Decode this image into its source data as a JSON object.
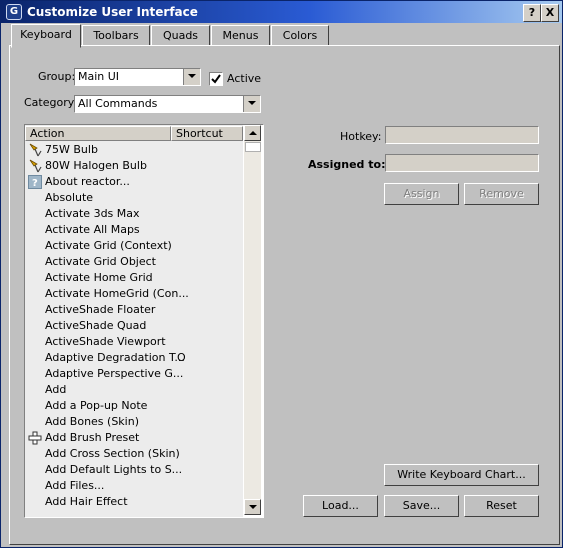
{
  "window": {
    "title": "Customize User Interface",
    "help_label": "?",
    "close_label": "X"
  },
  "tabs": [
    {
      "label": "Keyboard"
    },
    {
      "label": "Toolbars"
    },
    {
      "label": "Quads"
    },
    {
      "label": "Menus"
    },
    {
      "label": "Colors"
    }
  ],
  "group": {
    "label": "Group:",
    "value": "Main UI"
  },
  "active": {
    "label": "Active",
    "checked": true
  },
  "category": {
    "label": "Category:",
    "value": "All Commands"
  },
  "list": {
    "headers": {
      "action": "Action",
      "shortcut": "Shortcut"
    },
    "rows": [
      {
        "icon": "lamp-icon",
        "name": "75W Bulb",
        "shortcut": ""
      },
      {
        "icon": "lamp-icon",
        "name": "80W Halogen Bulb",
        "shortcut": ""
      },
      {
        "icon": "help-icon",
        "name": "About reactor...",
        "shortcut": ""
      },
      {
        "icon": "",
        "name": "Absolute",
        "shortcut": ""
      },
      {
        "icon": "",
        "name": "Activate 3ds Max",
        "shortcut": ""
      },
      {
        "icon": "",
        "name": "Activate All Maps",
        "shortcut": ""
      },
      {
        "icon": "",
        "name": "Activate Grid (Context)",
        "shortcut": ""
      },
      {
        "icon": "",
        "name": "Activate Grid Object",
        "shortcut": ""
      },
      {
        "icon": "",
        "name": "Activate Home Grid",
        "shortcut": ""
      },
      {
        "icon": "",
        "name": "Activate HomeGrid (Con...",
        "shortcut": ""
      },
      {
        "icon": "",
        "name": "ActiveShade Floater",
        "shortcut": ""
      },
      {
        "icon": "",
        "name": "ActiveShade Quad",
        "shortcut": ""
      },
      {
        "icon": "",
        "name": "ActiveShade Viewport",
        "shortcut": ""
      },
      {
        "icon": "",
        "name": "Adaptive Degradation T...",
        "shortcut": "O"
      },
      {
        "icon": "",
        "name": "Adaptive Perspective G...",
        "shortcut": ""
      },
      {
        "icon": "",
        "name": "Add",
        "shortcut": ""
      },
      {
        "icon": "",
        "name": "Add a Pop-up Note",
        "shortcut": ""
      },
      {
        "icon": "",
        "name": "Add Bones (Skin)",
        "shortcut": ""
      },
      {
        "icon": "crosshair-icon",
        "name": "Add Brush Preset",
        "shortcut": ""
      },
      {
        "icon": "",
        "name": "Add Cross Section (Skin)",
        "shortcut": ""
      },
      {
        "icon": "",
        "name": "Add Default Lights to S...",
        "shortcut": ""
      },
      {
        "icon": "",
        "name": "Add Files...",
        "shortcut": ""
      },
      {
        "icon": "",
        "name": "Add Hair Effect",
        "shortcut": ""
      }
    ]
  },
  "hotkey": {
    "label": "Hotkey:",
    "value": ""
  },
  "assigned_to": {
    "label": "Assigned to:",
    "value": ""
  },
  "buttons": {
    "assign": "Assign",
    "remove": "Remove",
    "write_chart": "Write Keyboard Chart...",
    "load": "Load...",
    "save": "Save...",
    "reset": "Reset"
  }
}
